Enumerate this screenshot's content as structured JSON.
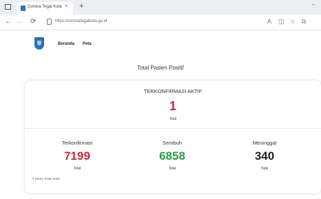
{
  "browser": {
    "tab_title": "Corona Tegal Kota",
    "tab_close": "×",
    "new_tab": "+",
    "url": "https://coronategalkota.go.id",
    "minimize": "–"
  },
  "nav": {
    "items": [
      "Beranda",
      "Peta"
    ]
  },
  "section_title": "Total Pasien Positif",
  "active": {
    "label": "TERKONFIRMASI AKTIF",
    "value": "1",
    "sub": "Total"
  },
  "stats": [
    {
      "label": "Terkonfirmasi",
      "value": "7199",
      "sub": "Total"
    },
    {
      "label": "Sembuh",
      "value": "6858",
      "sub": "Total"
    },
    {
      "label": "Meninggal",
      "value": "340",
      "sub": "Total"
    }
  ],
  "date_note": "*) Senin, 9 Mei 2022",
  "colors": {
    "confirmed": "#c8283a",
    "recovered": "#2a9a45",
    "death": "#222222",
    "logo": "#2f6fb6"
  }
}
